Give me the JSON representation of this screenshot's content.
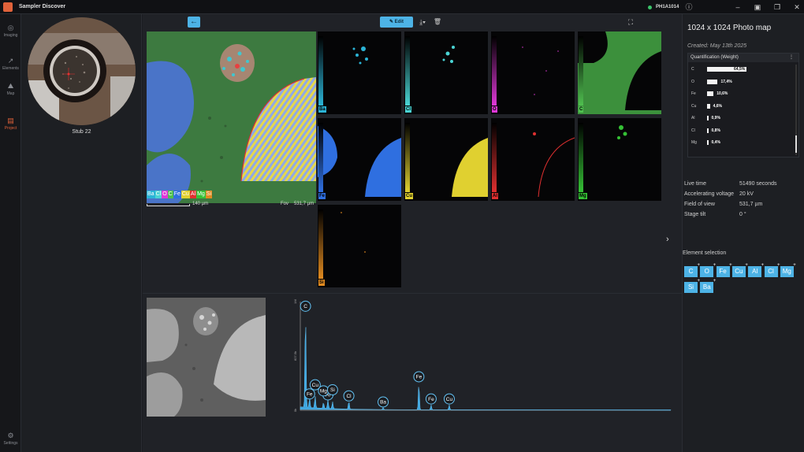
{
  "window": {
    "title": "Sampler Discover",
    "device": "PH1A1014"
  },
  "nav": [
    {
      "label": "Imaging",
      "icon": "camera-icon"
    },
    {
      "label": "Elements",
      "icon": "spectrum-icon"
    },
    {
      "label": "Map",
      "icon": "map-icon"
    },
    {
      "label": "Project",
      "icon": "document-icon",
      "active": true
    }
  ],
  "nav_settings": "Settings",
  "stub": {
    "label": "Stub 22"
  },
  "toolbar": {
    "edit_label": "Edit"
  },
  "map": {
    "legend": [
      {
        "el": "Ba",
        "color": "#2bb4d6"
      },
      {
        "el": "Cl",
        "color": "#4ad4d4"
      },
      {
        "el": "O",
        "color": "#e038d8"
      },
      {
        "el": "C",
        "color": "#4fbf4f"
      },
      {
        "el": "Fe",
        "color": "#2f6fe0"
      },
      {
        "el": "Cu",
        "color": "#e0d030"
      },
      {
        "el": "Al",
        "color": "#e03030"
      },
      {
        "el": "Mg",
        "color": "#35c135"
      },
      {
        "el": "Si",
        "color": "#e08a20"
      }
    ],
    "scale_label": "140 µm",
    "fov_label": "Fov",
    "fov_value": "531,7 µm"
  },
  "tiles": [
    {
      "el": "Ba",
      "color": "#2bb4d6"
    },
    {
      "el": "Cl",
      "color": "#4ad4d4"
    },
    {
      "el": "O",
      "color": "#e038d8"
    },
    {
      "el": "C",
      "color": "#4fbf4f"
    },
    {
      "el": "Fe",
      "color": "#2f6fe0"
    },
    {
      "el": "Cu",
      "color": "#e0d030"
    },
    {
      "el": "Al",
      "color": "#e03030"
    },
    {
      "el": "Mg",
      "color": "#35c135"
    },
    {
      "el": "Si",
      "color": "#e08a20"
    }
  ],
  "spectrum": {
    "y_ticks": [
      "1M",
      "827.5k",
      "0k"
    ],
    "peaks": [
      {
        "label": "C",
        "x": 0.28,
        "h": 0.97
      },
      {
        "label": "Fe",
        "x": 0.5,
        "h": 0.1
      },
      {
        "label": "Cu",
        "x": 0.8,
        "h": 0.12
      },
      {
        "label": "Al",
        "x": 1.49,
        "h": 0.09
      },
      {
        "label": "Mg",
        "x": 1.25,
        "h": 0.06
      },
      {
        "label": "Si",
        "x": 1.74,
        "h": 0.07
      },
      {
        "label": "Cl",
        "x": 2.62,
        "h": 0.08
      },
      {
        "label": "Ba",
        "x": 4.47,
        "h": 0.02
      },
      {
        "label": "Fe",
        "x": 6.4,
        "h": 0.27
      },
      {
        "label": "Fe",
        "x": 7.06,
        "h": 0.05
      },
      {
        "label": "Cu",
        "x": 8.04,
        "h": 0.05
      }
    ],
    "x_max": 20
  },
  "right": {
    "title": "1024 x 1024 Photo map",
    "created": "Created: May 13th 2025",
    "quant_title": "Quantification (Weight)",
    "quant": [
      {
        "el": "C",
        "pct": "64,5%",
        "value": 64.5
      },
      {
        "el": "O",
        "pct": "17,4%",
        "value": 17.4
      },
      {
        "el": "Fe",
        "pct": "10,6%",
        "value": 10.6
      },
      {
        "el": "Cu",
        "pct": "4,6%",
        "value": 4.6
      },
      {
        "el": "Al",
        "pct": "0,9%",
        "value": 0.9
      },
      {
        "el": "Cl",
        "pct": "0,8%",
        "value": 0.8
      },
      {
        "el": "Mg",
        "pct": "0,4%",
        "value": 0.4
      }
    ],
    "props": [
      {
        "k": "Live time",
        "v": "51490 seconds"
      },
      {
        "k": "Accelerating voltage",
        "v": "20 kV"
      },
      {
        "k": "Field of view",
        "v": "531,7 µm"
      },
      {
        "k": "Stage tilt",
        "v": "0 °"
      }
    ],
    "element_selection_label": "Element selection",
    "elements": [
      "C",
      "O",
      "Fe",
      "Cu",
      "Al",
      "Cl",
      "Mg",
      "Si",
      "Ba"
    ]
  }
}
